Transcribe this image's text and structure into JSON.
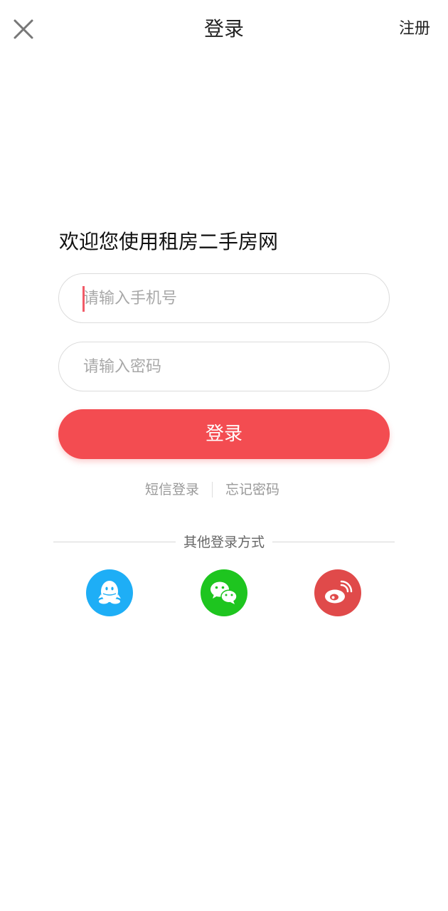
{
  "header": {
    "title": "登录",
    "register_label": "注册",
    "close_icon": "close-icon"
  },
  "welcome_text": "欢迎您使用租房二手房网",
  "phone_input": {
    "placeholder": "请输入手机号",
    "value": ""
  },
  "password_input": {
    "placeholder": "请输入密码",
    "value": ""
  },
  "login_button_label": "登录",
  "links": {
    "sms_login": "短信登录",
    "forgot_password": "忘记密码"
  },
  "other_login": {
    "label": "其他登录方式",
    "providers": [
      "qq-icon",
      "wechat-icon",
      "weibo-icon"
    ]
  },
  "colors": {
    "accent": "#f34c51",
    "qq": "#1eaef6",
    "wechat": "#1ec51f",
    "weibo": "#e04a4a"
  }
}
